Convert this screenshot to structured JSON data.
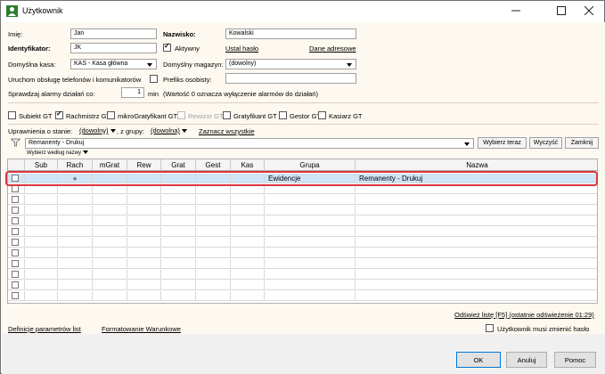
{
  "window": {
    "title": "Użytkownik",
    "minimize_icon": "minimize-icon",
    "maximize_icon": "maximize-icon",
    "close_icon": "close-icon"
  },
  "form": {
    "imie_label": "Imię:",
    "imie_value": "Jan",
    "nazwisko_label": "Nazwisko:",
    "nazwisko_value": "Kowalski",
    "identyfikator_label": "Identyfikator:",
    "identyfikator_value": "JK",
    "aktywny_label": "Aktywny",
    "aktywny_checked": true,
    "ustal_haslo": "Ustal hasło",
    "dane_adresowe": "Dane adresowe",
    "kasa_label": "Domyślna kasa:",
    "kasa_value": "KAS - Kasa główna",
    "magazyn_label": "Domyślny magazyn:",
    "magazyn_value": "(dowolny)",
    "telefony_label": "Uruchom obsługę telefonów i komunikatorów",
    "prefiks_label": "Prefiks osobisty:",
    "prefiks_value": "",
    "alarmy_label": "Sprawdzaj alarmy działań co:",
    "alarmy_value": "1",
    "alarmy_unit": "min",
    "alarmy_note": "(Wartość 0 oznacza wyłączenie alarmów do działań)"
  },
  "roles": [
    {
      "label": "Subiekt GT",
      "checked": false,
      "disabled": false
    },
    {
      "label": "Rachmistrz GT",
      "checked": true,
      "disabled": false
    },
    {
      "label": "mikroGratyfikant GT",
      "checked": false,
      "disabled": false
    },
    {
      "label": "Rewizor GT",
      "checked": false,
      "disabled": true
    },
    {
      "label": "Gratyfikant GT",
      "checked": false,
      "disabled": false
    },
    {
      "label": "Gestor GT",
      "checked": false,
      "disabled": false
    },
    {
      "label": "Kasiarz GT",
      "checked": false,
      "disabled": false
    }
  ],
  "permissions": {
    "stan_label": "Uprawnienia o stanie:",
    "stan_value": "(dowolny)",
    "grupa_label": ", z grupy:",
    "grupa_value": "(dowolna)",
    "zaznacz": "Zaznacz wszystkie",
    "filter_value": "Remanenty - Drukuj",
    "wybierz_wedlug": "Wybierz według nazwy",
    "btn_wybierz": "Wybierz teraz",
    "btn_wyczysc": "Wyczyść",
    "btn_zamknij": "Zamknij"
  },
  "grid": {
    "columns": [
      "Sub",
      "Rach",
      "mGrat",
      "Rew",
      "Grat",
      "Gest",
      "Kas",
      "Grupa",
      "Nazwa"
    ],
    "rows": [
      {
        "checked": false,
        "rach": "●",
        "grupa": "Ewidencje",
        "nazwa": "Remanenty - Drukuj",
        "selected": true
      }
    ],
    "empty_rows": 11
  },
  "bottom": {
    "odswiez": "Odśwież listę [F5] (ostatnie odświeżenie 01:29)",
    "definicje": "Definicje parametrów list",
    "formatowanie": "Formatowanie Warunkowe",
    "zmienic_haslo": "Użytkownik musi zmienić hasło",
    "ok": "OK",
    "anuluj": "Anuluj",
    "pomoc": "Pomoc"
  }
}
